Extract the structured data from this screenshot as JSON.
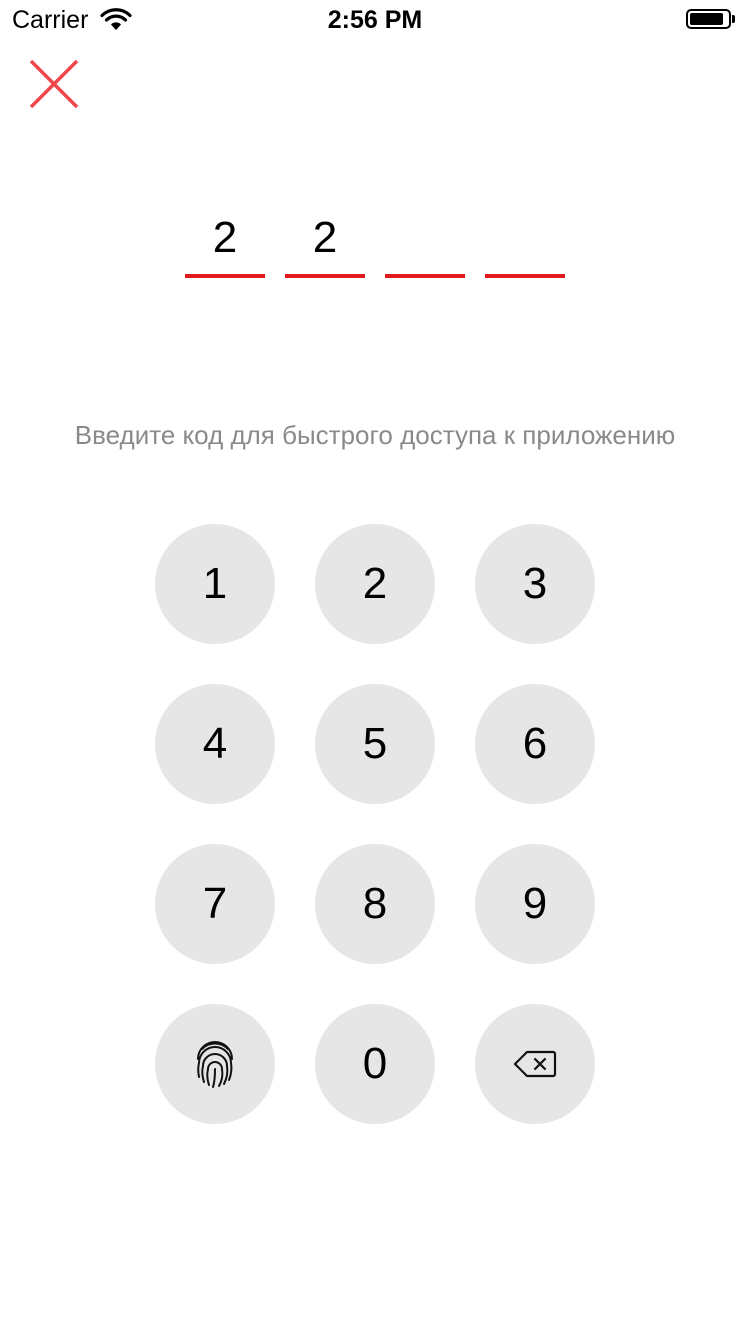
{
  "status_bar": {
    "carrier": "Carrier",
    "time": "2:56 PM",
    "battery_level": 0.85
  },
  "header": {
    "close_icon": "close-icon",
    "close_color": "#f0474d"
  },
  "pin": {
    "entered": [
      "2",
      "2",
      "",
      ""
    ],
    "length": 4,
    "underline_color": "#e01b1b"
  },
  "prompt": {
    "text": "Введите код для быстрого доступа к приложению"
  },
  "keypad": {
    "keys": [
      "1",
      "2",
      "3",
      "4",
      "5",
      "6",
      "7",
      "8",
      "9",
      "0"
    ],
    "biometric_icon": "fingerprint-icon",
    "delete_icon": "backspace-icon",
    "key_background": "#e6e6e6"
  }
}
